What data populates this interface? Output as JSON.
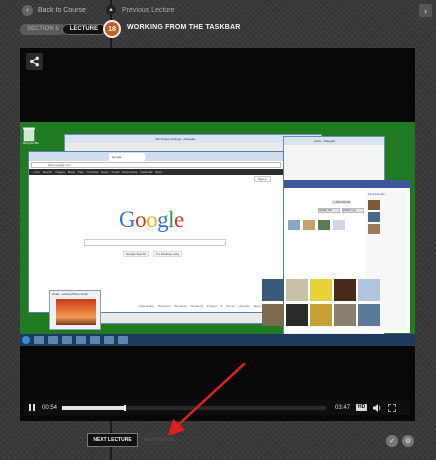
{
  "header": {
    "back_to_course": "Back to Course",
    "previous_lecture": "Previous Lecture",
    "section_label": "SECTION 5",
    "lecture_label": "LECTURE",
    "lecture_number": "18",
    "lecture_title": "WORKING FROM THE TASKBAR"
  },
  "video": {
    "screenshot": {
      "recycle_bin_label": "Recycle Bin",
      "notepad_title": "Job Project Listings - Notepad",
      "links_title": "Links - Notepad",
      "browser": {
        "tab_title": "Google",
        "address": "www.google.com",
        "nav_items": [
          "+You",
          "Search",
          "Images",
          "Maps",
          "Play",
          "YouTube",
          "News",
          "Gmail",
          "Documents",
          "Calendar",
          "More"
        ],
        "sign_in": "Sign in",
        "logo": [
          "G",
          "o",
          "o",
          "g",
          "l",
          "e"
        ],
        "search_button": "Google Search",
        "lucky_button": "I'm Feeling Lucky",
        "footer": [
          "Advertising Programs",
          "Business Solutions",
          "Privacy & Terms",
          "+Google",
          "About Google"
        ]
      },
      "thumbnail_label": "Chart - Library\\Photo Kiosk",
      "facebook": {
        "update_info": "Update Info",
        "activity_log": "Activity Log",
        "add_friend": "+ Add Friend",
        "find_friends": "Find Friends"
      }
    },
    "controls": {
      "current_time": "00:54",
      "duration": "03:47",
      "hd_label": "HD",
      "progress_fraction": 0.24
    }
  },
  "footer": {
    "next_lecture": "NEXT LECTURE",
    "autoplay": "Auto Play ON"
  },
  "colors": {
    "accent": "#cc5a1e",
    "annotation_arrow": "#e02020",
    "desktop_green": "#1f7a22"
  }
}
